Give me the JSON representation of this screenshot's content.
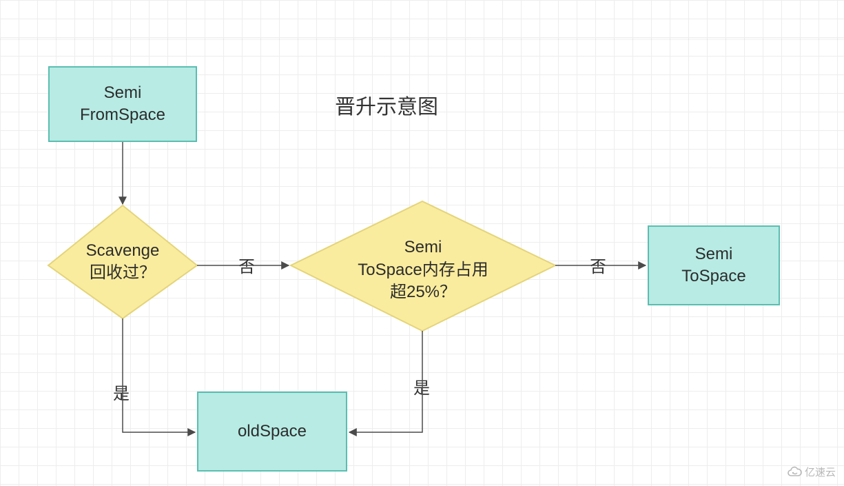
{
  "title": "晋升示意图",
  "nodes": {
    "from_space": {
      "label_line1": "Semi",
      "label_line2": "FromSpace"
    },
    "scavenge": {
      "label_line1": "Scavenge",
      "label_line2": "回收过？"
    },
    "tospace_mem": {
      "label_line1": "Semi",
      "label_line2": "ToSpace内存占用",
      "label_line3": "超25%？"
    },
    "to_space": {
      "label_line1": "Semi",
      "label_line2": "ToSpace"
    },
    "old_space": {
      "label": "oldSpace"
    }
  },
  "edges": {
    "scavenge_no": "否",
    "scavenge_yes": "是",
    "tospace_no": "否",
    "tospace_yes": "是"
  },
  "watermark": "亿速云"
}
